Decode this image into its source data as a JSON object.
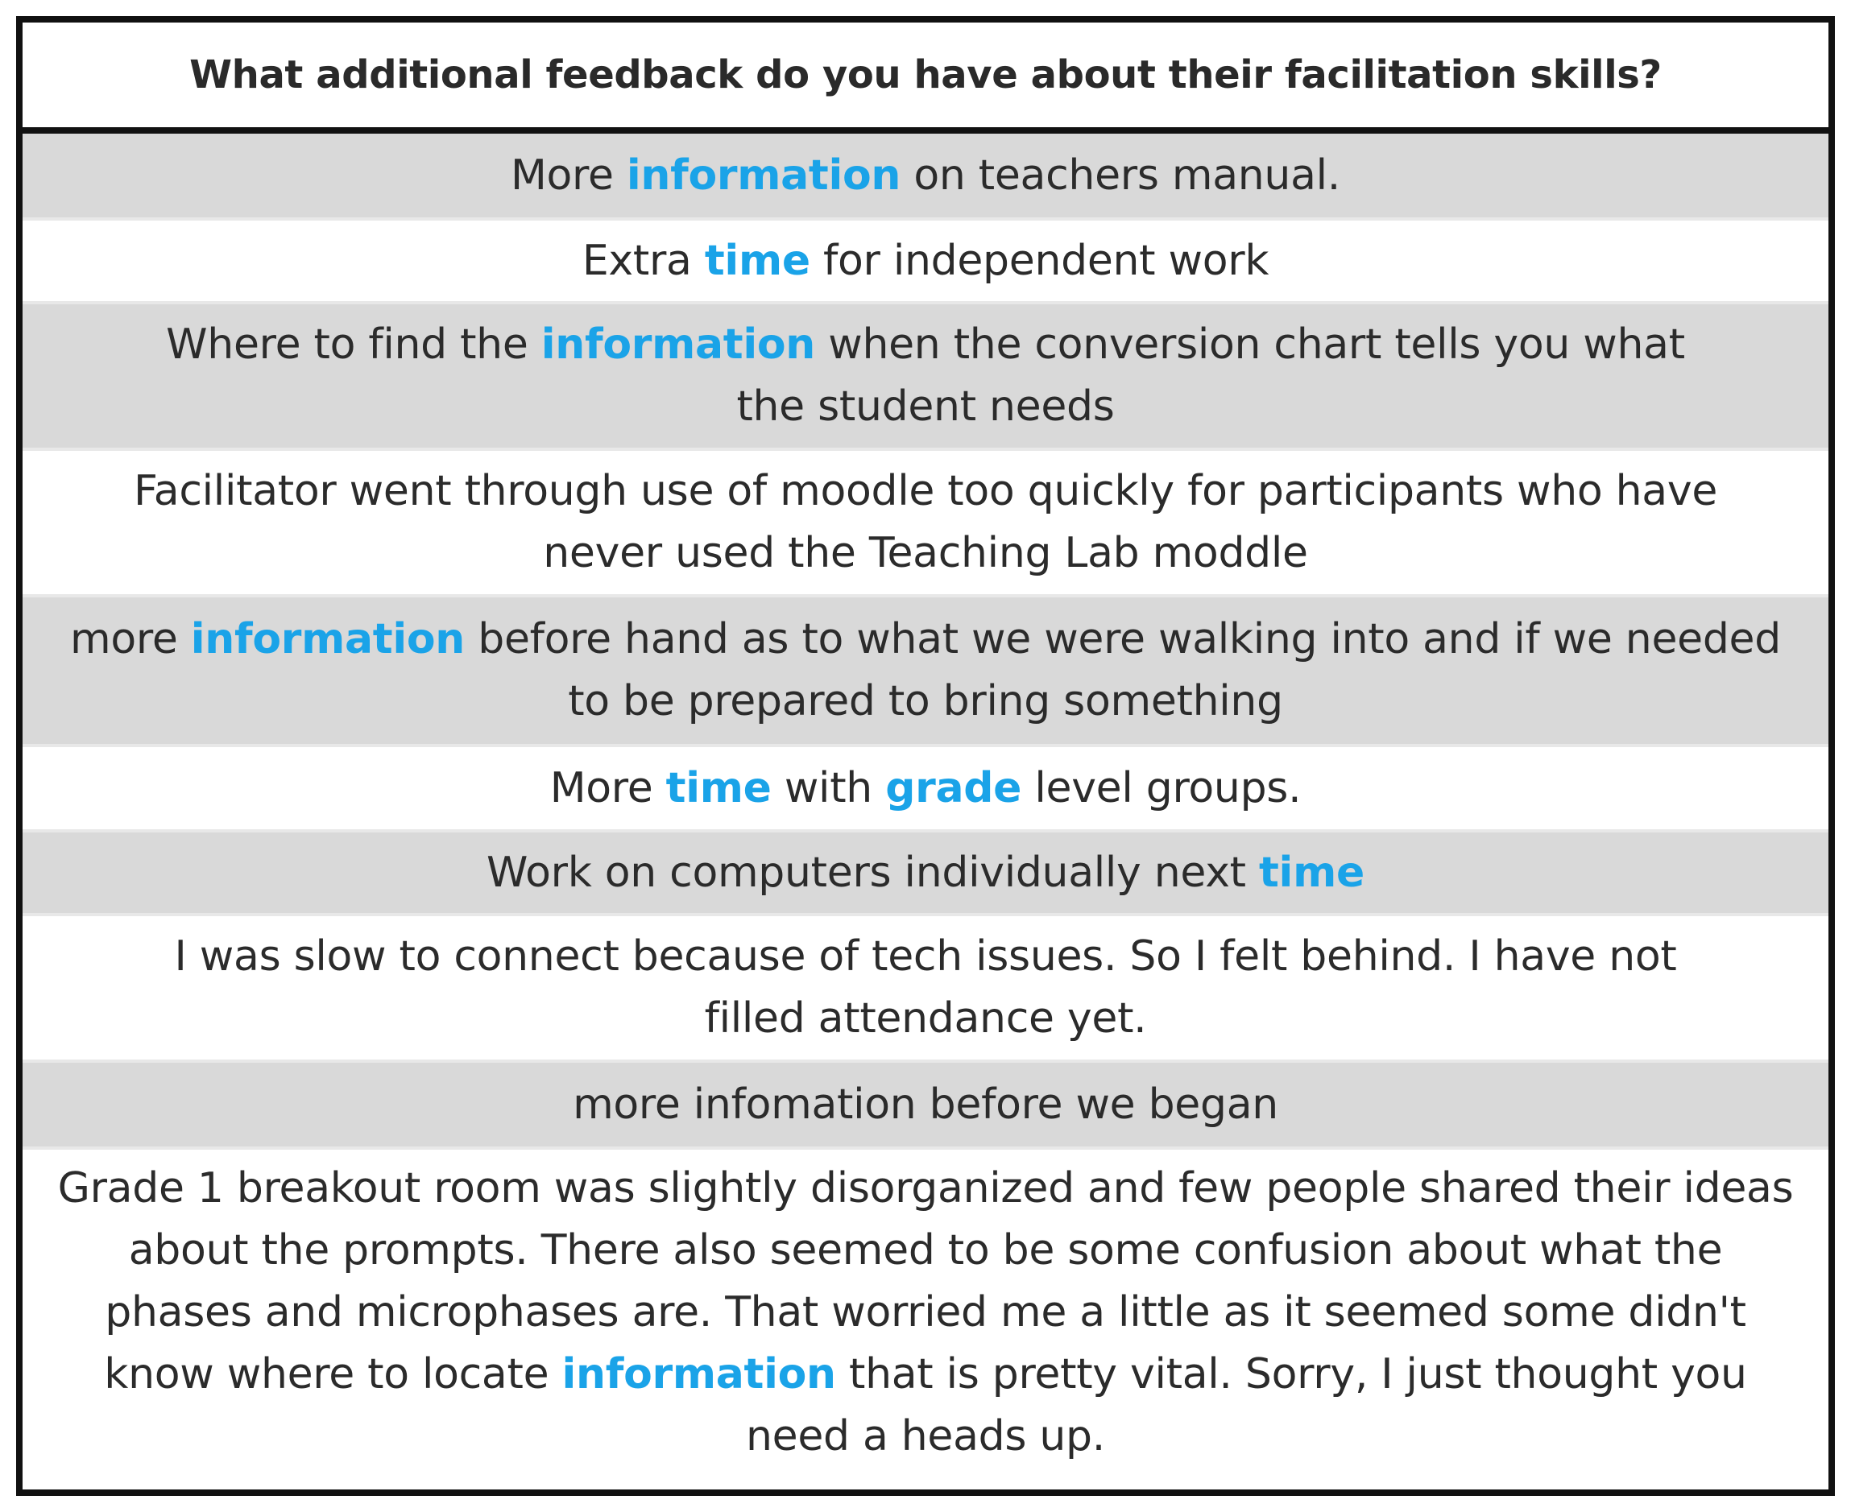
{
  "table": {
    "title": "What additional feedback do you have about their facilitation skills?",
    "keyword_color": "#1aa3e8",
    "shade_color": "#d9d9d9",
    "rows": [
      {
        "segments": [
          {
            "text": "More ",
            "highlight": false
          },
          {
            "text": "information",
            "highlight": true
          },
          {
            "text": " on teachers manual.",
            "highlight": false
          }
        ]
      },
      {
        "segments": [
          {
            "text": "Extra ",
            "highlight": false
          },
          {
            "text": "time",
            "highlight": true
          },
          {
            "text": " for independent work",
            "highlight": false
          }
        ]
      },
      {
        "segments": [
          {
            "text": "Where to find the ",
            "highlight": false
          },
          {
            "text": "information",
            "highlight": true
          },
          {
            "text": " when the conversion chart tells you what the student needs",
            "highlight": false
          }
        ]
      },
      {
        "segments": [
          {
            "text": "Facilitator went through use of moodle too quickly for participants who have never used the Teaching Lab moddle",
            "highlight": false
          }
        ]
      },
      {
        "segments": [
          {
            "text": "more ",
            "highlight": false
          },
          {
            "text": "information",
            "highlight": true
          },
          {
            "text": " before hand as to what we were walking into and if we needed to be prepared to bring something",
            "highlight": false
          }
        ]
      },
      {
        "segments": [
          {
            "text": "More ",
            "highlight": false
          },
          {
            "text": "time",
            "highlight": true
          },
          {
            "text": " with ",
            "highlight": false
          },
          {
            "text": "grade",
            "highlight": true
          },
          {
            "text": " level groups.",
            "highlight": false
          }
        ]
      },
      {
        "segments": [
          {
            "text": "Work on computers individually next ",
            "highlight": false
          },
          {
            "text": "time",
            "highlight": true
          }
        ]
      },
      {
        "segments": [
          {
            "text": "I was slow to connect because of tech issues. So I felt behind. I have not filled attendance yet.",
            "highlight": false
          }
        ]
      },
      {
        "segments": [
          {
            "text": "more infomation before we began",
            "highlight": false
          }
        ]
      },
      {
        "segments": [
          {
            "text": "Grade 1 breakout room was slightly disorganized and few people shared their ideas about the prompts. There also seemed to be some confusion about what the phases and microphases are. That worried me a little as it seemed some didn't know where to locate ",
            "highlight": false
          },
          {
            "text": "information",
            "highlight": true
          },
          {
            "text": " that is pretty vital. Sorry, I just thought you need a heads up.",
            "highlight": false
          }
        ]
      }
    ]
  }
}
